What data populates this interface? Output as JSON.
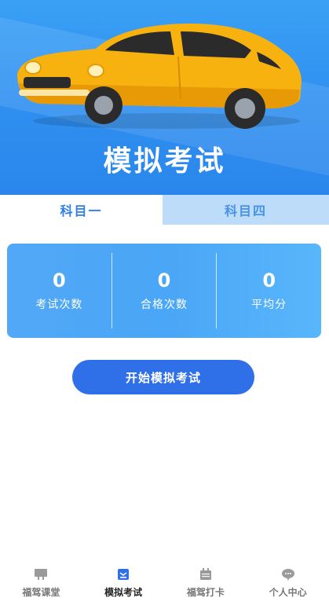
{
  "hero": {
    "title": "模拟考试"
  },
  "tabs": [
    {
      "label": "科目一",
      "active": true
    },
    {
      "label": "科目四",
      "active": false
    }
  ],
  "stats": [
    {
      "value": "0",
      "label": "考试次数"
    },
    {
      "value": "0",
      "label": "合格次数"
    },
    {
      "value": "0",
      "label": "平均分"
    }
  ],
  "start_button": {
    "label": "开始模拟考试"
  },
  "bottom_nav": [
    {
      "label": "福驾课堂",
      "icon": "classroom-icon",
      "active": false
    },
    {
      "label": "模拟考试",
      "icon": "exam-icon",
      "active": true
    },
    {
      "label": "福驾打卡",
      "icon": "calendar-icon",
      "active": false
    },
    {
      "label": "个人中心",
      "icon": "chat-bubble-icon",
      "active": false
    }
  ],
  "colors": {
    "primary": "#2f6fe8",
    "hero_blue": "#3aa0f5",
    "tab_inactive_bg": "#bcdcfa",
    "car_body": "#f7b20f"
  }
}
